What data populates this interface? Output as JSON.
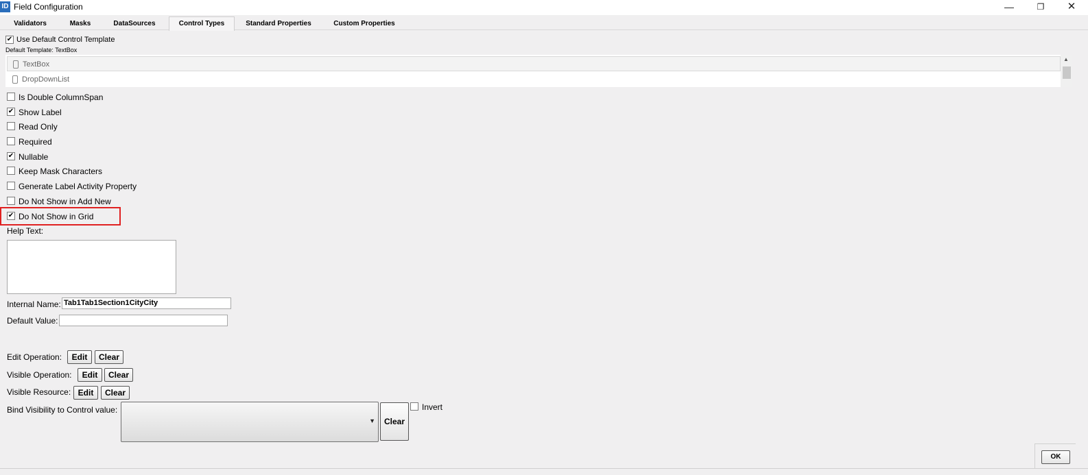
{
  "window": {
    "title": "Field Configuration",
    "icon_text": "ID",
    "minimize": "—",
    "maximize": "❐",
    "close": "✕"
  },
  "tabs": [
    "Validators",
    "Masks",
    "DataSources",
    "Control Types",
    "Standard Properties",
    "Custom Properties"
  ],
  "active_tab": "Control Types",
  "template": {
    "use_default_label": "Use Default Control Template",
    "use_default_checked": true,
    "default_template_text": "Default Template: TextBox",
    "items": [
      "TextBox",
      "DropDownList"
    ]
  },
  "options": [
    {
      "label": "Is Double ColumnSpan",
      "checked": false
    },
    {
      "label": "Show Label",
      "checked": true
    },
    {
      "label": "Read Only",
      "checked": false
    },
    {
      "label": "Required",
      "checked": false
    },
    {
      "label": "Nullable",
      "checked": true
    },
    {
      "label": "Keep Mask Characters",
      "checked": false
    },
    {
      "label": "Generate Label Activity Property",
      "checked": false
    },
    {
      "label": "Do Not Show in Add New",
      "checked": false
    },
    {
      "label": "Do Not Show in Grid",
      "checked": true
    }
  ],
  "help_text_label": "Help Text:",
  "help_text_value": "",
  "internal_name": {
    "label": "Internal Name:",
    "value": "Tab1Tab1Section1CityCity"
  },
  "default_value": {
    "label": "Default Value:",
    "value": ""
  },
  "operations": [
    {
      "label": "Edit Operation:",
      "edit": "Edit",
      "clear": "Clear"
    },
    {
      "label": "Visible Operation:",
      "edit": "Edit",
      "clear": "Clear"
    },
    {
      "label": "Visible Resource:",
      "edit": "Edit",
      "clear": "Clear"
    }
  ],
  "bind_visibility": {
    "label": "Bind Visibility to Control value:",
    "value": "",
    "clear": "Clear",
    "invert_label": "Invert",
    "invert_checked": false
  },
  "ok_label": "OK"
}
